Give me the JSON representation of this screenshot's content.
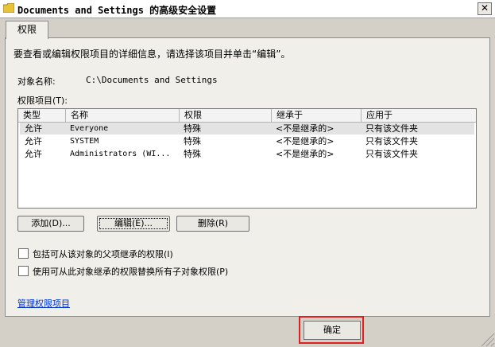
{
  "window": {
    "title": "Documents and Settings 的高级安全设置",
    "close_glyph": "✕"
  },
  "tabs": [
    {
      "label": "权限"
    }
  ],
  "description": "要查看或编辑权限项目的详细信息，请选择该项目并单击“编辑”。",
  "object": {
    "label": "对象名称:",
    "value": "C:\\Documents and Settings"
  },
  "entries_label": "权限项目(T):",
  "columns": [
    "类型",
    "名称",
    "权限",
    "继承于",
    "应用于"
  ],
  "rows": [
    {
      "type": "允许",
      "name": "Everyone",
      "permission": "特殊",
      "inherited_from": "<不是继承的>",
      "applies_to": "只有该文件夹",
      "selected": true
    },
    {
      "type": "允许",
      "name": "SYSTEM",
      "permission": "特殊",
      "inherited_from": "<不是继承的>",
      "applies_to": "只有该文件夹",
      "selected": false
    },
    {
      "type": "允许",
      "name": "Administrators (WI...",
      "permission": "特殊",
      "inherited_from": "<不是继承的>",
      "applies_to": "只有该文件夹",
      "selected": false
    }
  ],
  "buttons": {
    "add": "添加(D)...",
    "edit": "编辑(E)...",
    "remove": "删除(R)"
  },
  "checkboxes": [
    {
      "label": "包括可从该对象的父项继承的权限(I)",
      "checked": false
    },
    {
      "label": "使用可从此对象继承的权限替换所有子对象权限(P)",
      "checked": false
    }
  ],
  "manage_link": "管理权限项目",
  "ok_button": "确定",
  "colors": {
    "highlight_box": "#e02020",
    "selected_row": "#e3e3e3",
    "link": "#0033cc"
  }
}
